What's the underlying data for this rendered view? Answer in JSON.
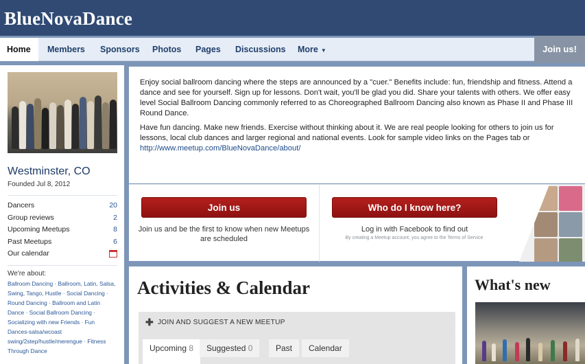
{
  "site": {
    "name": "BlueNovaDance"
  },
  "nav": {
    "tabs": [
      "Home",
      "Members",
      "Sponsors",
      "Photos",
      "Pages",
      "Discussions",
      "More"
    ],
    "active": "Home",
    "join_label": "Join us!"
  },
  "group": {
    "city": "Westminster, CO",
    "founded": "Founded Jul 8, 2012",
    "stats": [
      {
        "label": "Dancers",
        "value": "20"
      },
      {
        "label": "Group reviews",
        "value": "2"
      },
      {
        "label": "Upcoming Meetups",
        "value": "8"
      },
      {
        "label": "Past Meetups",
        "value": "6"
      },
      {
        "label": "Our calendar",
        "value": ""
      }
    ],
    "about_label": "We're about:",
    "about_topics": "Ballroom Dancing · Ballroom, Latin, Salsa, Swing, Tango, Hustle · Social Dancing · Round Dancing · Ballroom and Latin Dance · Social Ballroom Dancing · Socializing with new Friends · Fun Dances-salsa/wcoast swing/2step/hustle/merengue · Fitness Through Dance"
  },
  "description": {
    "p1": "Enjoy social ballroom dancing where the steps are announced by a \"cuer.\" Benefits include: fun, friendship and fitness. Attend a dance and see for yourself. Sign up for lessons. Don't wait, you'll be glad you did. Share your talents with others. We offer easy level Social Ballroom Dancing commonly referred to as Choreographed Ballroom Dancing also known as Phase II and Phase III Round Dance.",
    "p2": "Have fun dancing. Make new friends. Exercise without thinking about it. We are real people looking for others to join us for lessons, local club dances and larger regional and national events. Look for sample video links on the Pages tab or ",
    "link": "http://www.meetup.com/BlueNovaDance/about/"
  },
  "cta": {
    "join_button": "Join us",
    "join_text": "Join us and be the first to know when new Meetups are scheduled",
    "who_button": "Who do I know here?",
    "who_text": "Log in with Facebook to find out",
    "who_fine": "By creating a Meetup account, you agree to the Terms of Service"
  },
  "activities": {
    "title": "Activities & Calendar",
    "suggest": "JOIN AND SUGGEST A NEW MEETUP",
    "tabs": [
      {
        "label": "Upcoming",
        "count": "8"
      },
      {
        "label": "Suggested",
        "count": "0"
      },
      {
        "label": "Past",
        "count": ""
      },
      {
        "label": "Calendar",
        "count": ""
      }
    ]
  },
  "whats_new": {
    "title": "What's new"
  },
  "colors": {
    "header": "#304a73",
    "nav": "#e6edf7",
    "background": "#7d96b8",
    "button_red": "#a0171a",
    "link": "#2b5796"
  }
}
